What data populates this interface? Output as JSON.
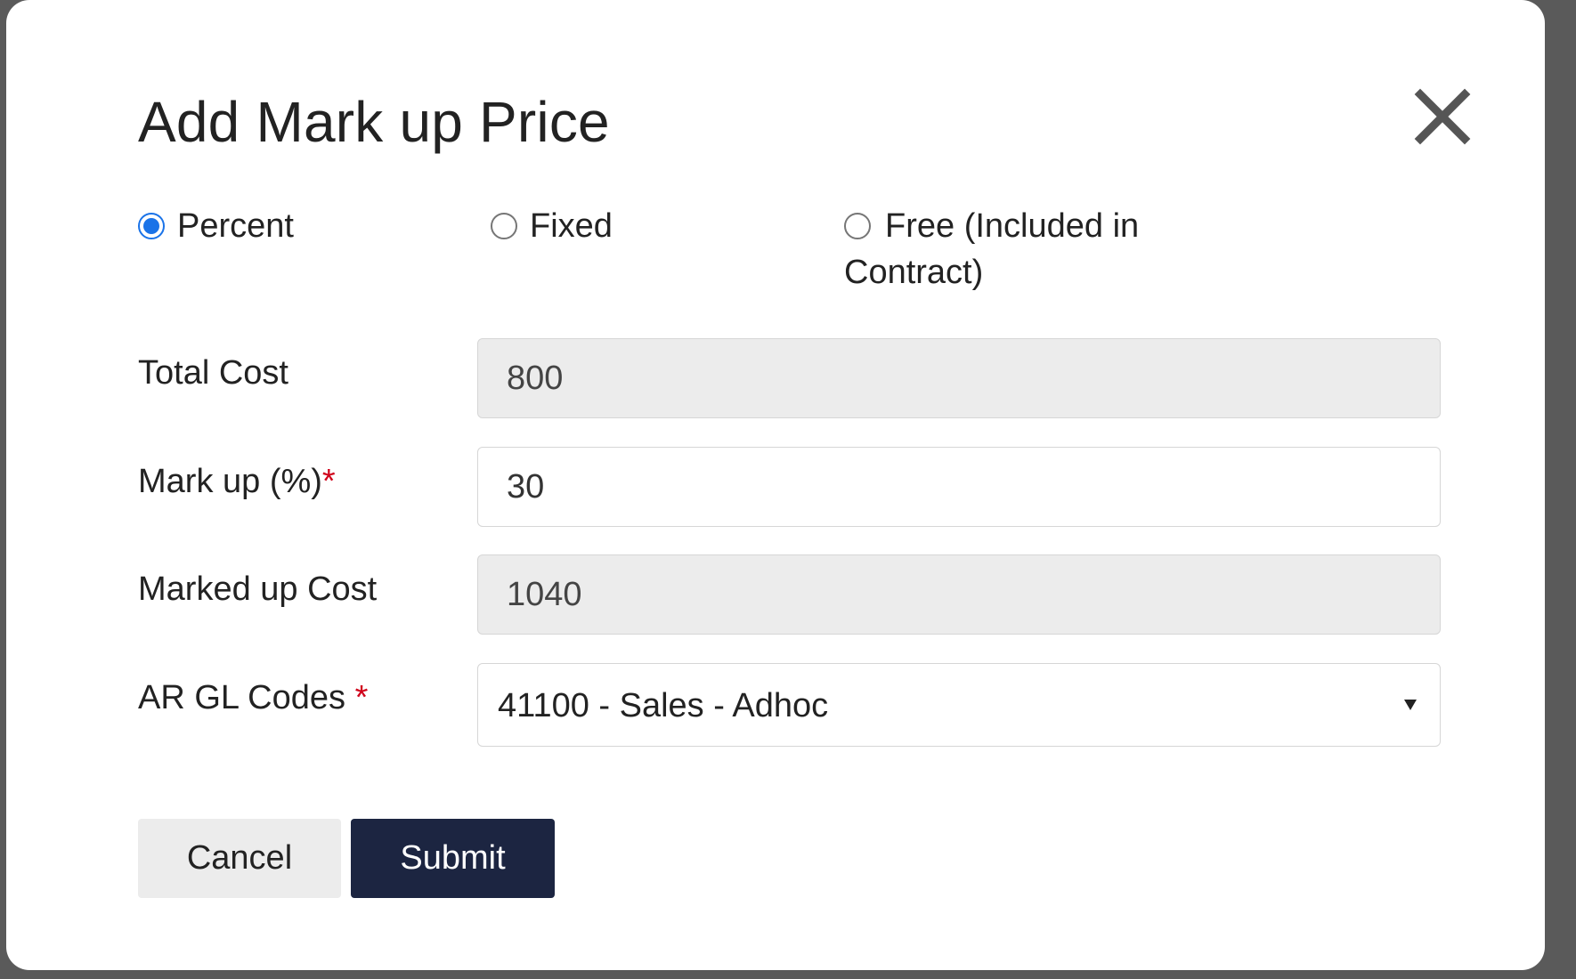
{
  "dialog": {
    "title": "Add Mark up Price",
    "close_icon": "close-icon"
  },
  "markup_type": {
    "options": [
      {
        "label": "Percent",
        "checked": true
      },
      {
        "label": "Fixed",
        "checked": false
      },
      {
        "label": "Free (Included in Contract)",
        "checked": false
      }
    ]
  },
  "fields": {
    "total_cost": {
      "label": "Total Cost",
      "value": "800",
      "readonly": true
    },
    "markup_percent": {
      "label": "Mark up (%)",
      "required_marker": "*",
      "value": "30"
    },
    "marked_up_cost": {
      "label": "Marked up Cost",
      "value": "1040",
      "readonly": true
    },
    "ar_gl_codes": {
      "label": "AR GL Codes ",
      "required_marker": "*",
      "selected": "41100 - Sales - Adhoc"
    }
  },
  "actions": {
    "cancel_label": "Cancel",
    "submit_label": "Submit"
  },
  "colors": {
    "submit_bg": "#1c2541",
    "radio_accent": "#1a73e8",
    "required": "#d0021b"
  }
}
